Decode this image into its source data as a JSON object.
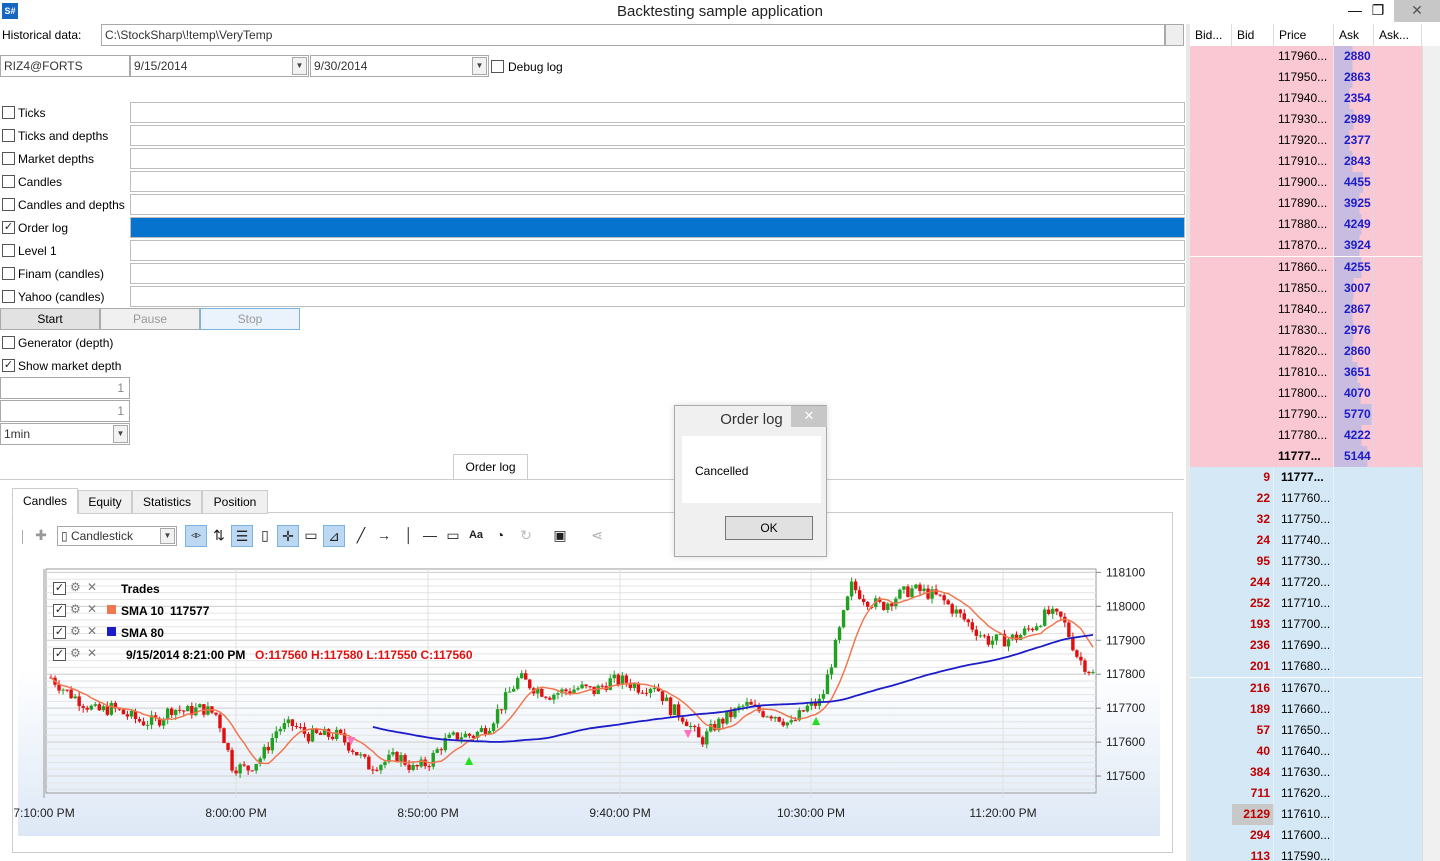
{
  "window": {
    "app_icon": "S#",
    "title": "Backtesting sample application",
    "minimize": "—",
    "restore": "❐",
    "close": "✕"
  },
  "form": {
    "historical_label": "Historical data:",
    "historical_path": "C:\\StockSharp\\!temp\\VeryTemp",
    "security": "RIZ4@FORTS",
    "start_date": "9/15/2014",
    "end_date": "9/30/2014",
    "debug_log_label": "Debug log",
    "debug_log_checked": false
  },
  "sources": [
    {
      "label": "Ticks",
      "checked": false,
      "progress": 0
    },
    {
      "label": "Ticks and depths",
      "checked": false,
      "progress": 0
    },
    {
      "label": "Market depths",
      "checked": false,
      "progress": 0
    },
    {
      "label": "Candles",
      "checked": false,
      "progress": 0
    },
    {
      "label": "Candles and depths",
      "checked": false,
      "progress": 0
    },
    {
      "label": "Order log",
      "checked": true,
      "progress": 1
    },
    {
      "label": "Level 1",
      "checked": false,
      "progress": 0
    },
    {
      "label": "Finam (candles)",
      "checked": false,
      "progress": 0
    },
    {
      "label": "Yahoo (candles)",
      "checked": false,
      "progress": 0
    }
  ],
  "controls": {
    "start": "Start",
    "pause": "Pause",
    "stop": "Stop",
    "generator_label": "Generator (depth)",
    "generator_checked": false,
    "show_depth_label": "Show market depth",
    "show_depth_checked": true,
    "num1": "1",
    "num2": "1",
    "timeframe": "1min"
  },
  "orderlog_tab": "Order log",
  "tabs": [
    "Candles",
    "Equity",
    "Statistics",
    "Position"
  ],
  "chart_toolbar": {
    "chart_style": "Candlestick"
  },
  "legend": {
    "trades": "Trades",
    "sma10_label": "SMA 10",
    "sma10_value": "117577",
    "sma80_label": "SMA 80",
    "ohlc_time": "9/15/2014 8:21:00 PM",
    "ohlc": "O:117560 H:117580 L:117550 C:117560"
  },
  "chart_data": {
    "type": "candlestick",
    "y_ticks": [
      "118100",
      "118000",
      "117900",
      "117800",
      "117700",
      "117600",
      "117500"
    ],
    "x_ticks": [
      "7:10:00 PM",
      "8:00:00 PM",
      "8:50:00 PM",
      "9:40:00 PM",
      "10:30:00 PM",
      "11:20:00 PM"
    ],
    "ylim": [
      117450,
      118110
    ],
    "colors": {
      "up": "#22a022",
      "down": "#e01010",
      "sma10": "#f07850",
      "sma80": "#1c1cc8"
    },
    "close_series_approx": [
      117790,
      117750,
      117720,
      117690,
      117700,
      117680,
      117660,
      117660,
      117700,
      117690,
      117700,
      117680,
      117530,
      117520,
      117560,
      117640,
      117650,
      117620,
      117620,
      117620,
      117580,
      117530,
      117540,
      117560,
      117520,
      117540,
      117600,
      117620,
      117620,
      117650,
      117720,
      117790,
      117760,
      117740,
      117750,
      117760,
      117750,
      117780,
      117780,
      117760,
      117770,
      117700,
      117670,
      117600,
      117650,
      117680,
      117710,
      117690,
      117680,
      117650,
      117700,
      117720,
      117890,
      118060,
      118020,
      118000,
      118030,
      118050,
      118040,
      118020,
      117980,
      117940,
      117900,
      117900,
      117910,
      117940,
      117980,
      117960,
      117850,
      117800
    ]
  },
  "dialog": {
    "title": "Order log",
    "message": "Cancelled",
    "ok": "OK",
    "close": "✕"
  },
  "orderbook": {
    "headers": [
      "Bid...",
      "Bid",
      "Price",
      "Ask",
      "Ask..."
    ],
    "asks": [
      {
        "price": "117960...",
        "vol": "2880"
      },
      {
        "price": "117950...",
        "vol": "2863"
      },
      {
        "price": "117940...",
        "vol": "2354"
      },
      {
        "price": "117930...",
        "vol": "2989"
      },
      {
        "price": "117920...",
        "vol": "2377"
      },
      {
        "price": "117910...",
        "vol": "2843"
      },
      {
        "price": "117900...",
        "vol": "4455"
      },
      {
        "price": "117890...",
        "vol": "3925"
      },
      {
        "price": "117880...",
        "vol": "4249"
      },
      {
        "price": "117870...",
        "vol": "3924"
      },
      {
        "price": "117860...",
        "vol": "4255"
      },
      {
        "price": "117850...",
        "vol": "3007"
      },
      {
        "price": "117840...",
        "vol": "2867"
      },
      {
        "price": "117830...",
        "vol": "2976"
      },
      {
        "price": "117820...",
        "vol": "2860"
      },
      {
        "price": "117810...",
        "vol": "3651"
      },
      {
        "price": "117800...",
        "vol": "4070"
      },
      {
        "price": "117790...",
        "vol": "5770"
      },
      {
        "price": "117780...",
        "vol": "4222"
      },
      {
        "price": "11777...",
        "vol": "5144"
      }
    ],
    "bids": [
      {
        "price": "11777...",
        "vol": "9"
      },
      {
        "price": "117760...",
        "vol": "22"
      },
      {
        "price": "117750...",
        "vol": "32"
      },
      {
        "price": "117740...",
        "vol": "24"
      },
      {
        "price": "117730...",
        "vol": "95"
      },
      {
        "price": "117720...",
        "vol": "244"
      },
      {
        "price": "117710...",
        "vol": "252"
      },
      {
        "price": "117700...",
        "vol": "193"
      },
      {
        "price": "117690...",
        "vol": "236"
      },
      {
        "price": "117680...",
        "vol": "201"
      },
      {
        "price": "117670...",
        "vol": "216"
      },
      {
        "price": "117660...",
        "vol": "189"
      },
      {
        "price": "117650...",
        "vol": "57"
      },
      {
        "price": "117640...",
        "vol": "40"
      },
      {
        "price": "117630...",
        "vol": "384"
      },
      {
        "price": "117620...",
        "vol": "711"
      },
      {
        "price": "117610...",
        "vol": "2129"
      },
      {
        "price": "117600...",
        "vol": "294"
      },
      {
        "price": "117590...",
        "vol": "113"
      }
    ]
  }
}
